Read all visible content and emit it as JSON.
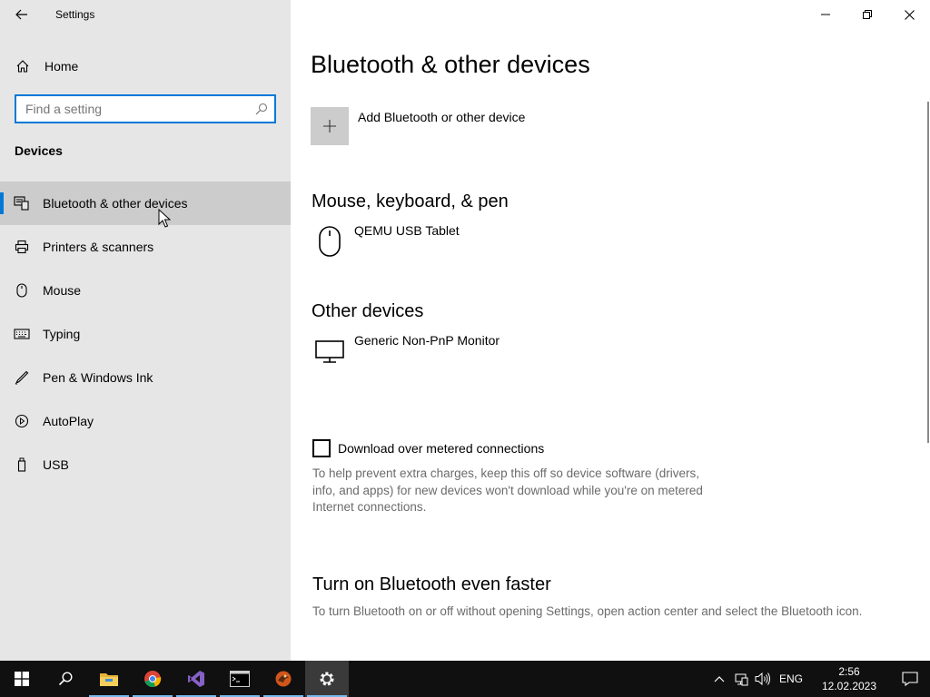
{
  "window": {
    "title": "Settings"
  },
  "nav": {
    "home_label": "Home",
    "search_placeholder": "Find a setting",
    "section_header": "Devices",
    "items": [
      {
        "label": "Bluetooth & other devices",
        "icon": "bluetooth-devices-icon",
        "active": true
      },
      {
        "label": "Printers & scanners",
        "icon": "printer-icon",
        "active": false
      },
      {
        "label": "Mouse",
        "icon": "mouse-icon",
        "active": false
      },
      {
        "label": "Typing",
        "icon": "keyboard-icon",
        "active": false
      },
      {
        "label": "Pen & Windows Ink",
        "icon": "pen-icon",
        "active": false
      },
      {
        "label": "AutoPlay",
        "icon": "autoplay-icon",
        "active": false
      },
      {
        "label": "USB",
        "icon": "usb-icon",
        "active": false
      }
    ]
  },
  "main": {
    "page_title": "Bluetooth & other devices",
    "add_device_label": "Add Bluetooth or other device",
    "groups": [
      {
        "title": "Mouse, keyboard, & pen",
        "devices": [
          {
            "name": "QEMU USB Tablet",
            "icon": "mouse-icon"
          }
        ]
      },
      {
        "title": "Other devices",
        "devices": [
          {
            "name": "Generic Non-PnP Monitor",
            "icon": "monitor-icon"
          }
        ]
      }
    ],
    "metered": {
      "label": "Download over metered connections",
      "checked": false,
      "help": "To help prevent extra charges, keep this off so device software (drivers, info, and apps) for new devices won't download while you're on metered Internet connections."
    },
    "bt_faster": {
      "title": "Turn on Bluetooth even faster",
      "description": "To turn Bluetooth on or off without opening Settings, open action center and select the Bluetooth icon."
    }
  },
  "taskbar": {
    "apps": [
      "start-icon",
      "search-icon",
      "file-explorer-icon",
      "chrome-icon",
      "visual-studio-icon",
      "terminal-icon",
      "app-icon",
      "settings-icon"
    ],
    "language": "ENG",
    "time": "2:56",
    "date": "12.02.2023"
  },
  "colors": {
    "accent": "#0078d7",
    "nav_background": "#e6e6e6",
    "nav_selected": "#cccccc",
    "taskbar": "#101010",
    "secondary_text": "#6b6b6b"
  }
}
